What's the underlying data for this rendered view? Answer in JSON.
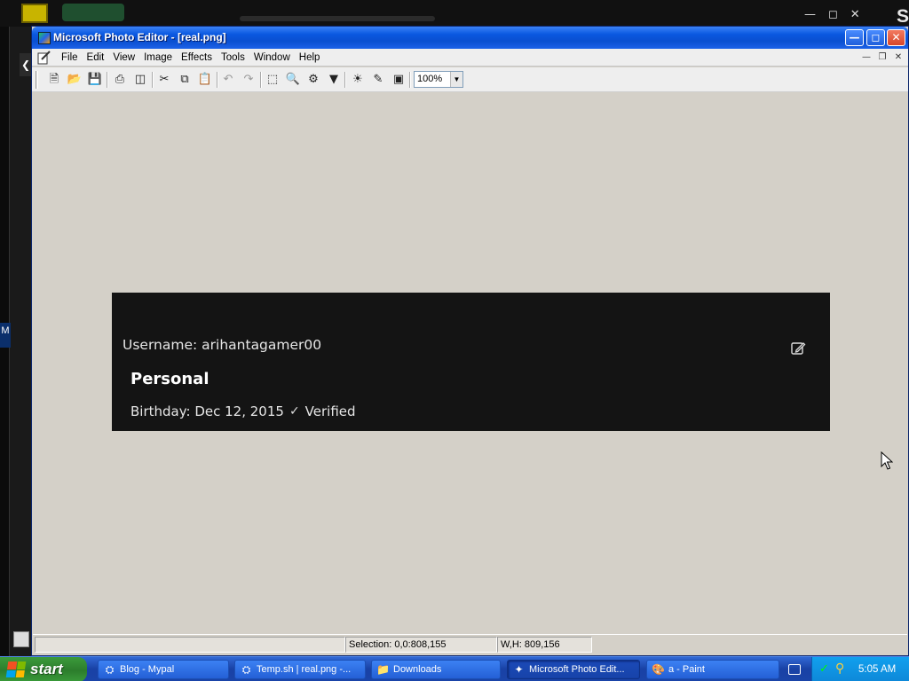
{
  "window": {
    "title": "Microsoft Photo Editor - [real.png]"
  },
  "menu": {
    "items": [
      "File",
      "Edit",
      "View",
      "Image",
      "Effects",
      "Tools",
      "Window",
      "Help"
    ]
  },
  "toolbar": {
    "zoom": "100%",
    "icons": [
      "new-icon",
      "open-icon",
      "save-icon",
      "print-icon",
      "scan-icon",
      "cut-icon",
      "copy-icon",
      "paste-icon",
      "undo-icon",
      "redo-icon",
      "select-icon",
      "zoom-icon",
      "stamp-icon",
      "funnel-icon",
      "sun-icon",
      "pen-icon",
      "crop-icon"
    ]
  },
  "image": {
    "username": "Username: arihantagamer00",
    "section": "Personal",
    "birthday": "Birthday: Dec 12, 2015",
    "verified": "Verified"
  },
  "status": {
    "selection": "Selection: 0,0:808,155",
    "size": "W,H: 809,156"
  },
  "taskbar": {
    "start": "start",
    "items": [
      {
        "label": "Blog - Mypal"
      },
      {
        "label": "Temp.sh | real.png -..."
      },
      {
        "label": "Downloads"
      },
      {
        "label": "Microsoft Photo Edit..."
      },
      {
        "label": "a - Paint"
      }
    ],
    "clock": "5:05 AM"
  },
  "background": {
    "side_letter": "M",
    "top_letter": "S"
  },
  "colors": {
    "titlebar": "#0a58e0",
    "taskbar": "#1941a5",
    "start_green": "#2c7d2c",
    "image_background": "#141414",
    "workspace": "#d4d0c8"
  }
}
